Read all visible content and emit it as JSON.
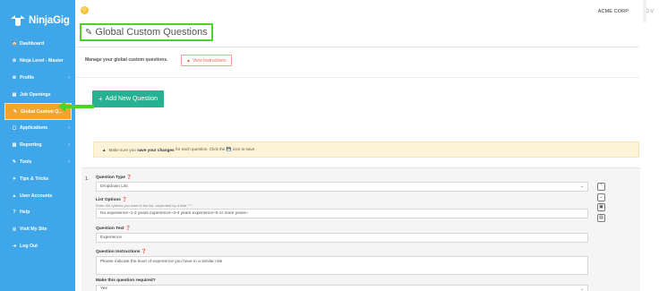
{
  "brand": {
    "name": "NinjaGig"
  },
  "topbar": {
    "company": "ACME CORP",
    "user_short": "⏻ V"
  },
  "sidebar": {
    "items": [
      {
        "label": "Dashboard",
        "icon": "🏠",
        "has_chevron": false
      },
      {
        "label": "Ninja Level - Master",
        "icon": "⚙",
        "has_chevron": false
      },
      {
        "label": "Profile",
        "icon": "⚙",
        "has_chevron": true
      },
      {
        "label": "Job Openings",
        "icon": "▤",
        "has_chevron": false
      },
      {
        "label": "Global Custom Q...",
        "icon": "✎",
        "has_chevron": false,
        "active": true
      },
      {
        "label": "Applications",
        "icon": "▢",
        "has_chevron": true
      },
      {
        "label": "Reporting",
        "icon": "▥",
        "has_chevron": true
      },
      {
        "label": "Tools",
        "icon": "✎",
        "has_chevron": true
      },
      {
        "label": "Tips & Tricks",
        "icon": "✦",
        "has_chevron": false
      },
      {
        "label": "User Accounts",
        "icon": "▲",
        "has_chevron": false
      },
      {
        "label": "Help",
        "icon": "?",
        "has_chevron": false
      },
      {
        "label": "Visit My Site",
        "icon": "◎",
        "has_chevron": false
      },
      {
        "label": "Log Out",
        "icon": "⇥",
        "has_chevron": false
      }
    ]
  },
  "page": {
    "title": "Global Custom Questions",
    "description": "Manage your global custom questions.",
    "view_instructions": "View Instructions",
    "add_button": "Add New Question",
    "alert_prefix": "Make sure you",
    "alert_bold": "save your changes",
    "alert_suffix": "for each question. Click the 💾 icon to save."
  },
  "question": {
    "number": "1.",
    "type_label": "Question Type ❓",
    "type_value": "Dropdown List",
    "options_label": "List Options ❓",
    "options_hint": "Enter the options you want in the list, separated by a tilde \"~\".",
    "options_value": "No experience~1-2 years experience~3-4 years experience~5 or more years~",
    "text_label": "Question Text ❓",
    "text_value": "Experience",
    "instructions_label": "Question Instructions ❓",
    "instructions_value": "Please indicate the level of experience you have in a similar role",
    "required_label": "Make this question required?",
    "required_value": "Yes"
  },
  "colors": {
    "sidebar": "#3fa7e9",
    "active": "#f3a42c",
    "highlight": "#4cd22a",
    "add_button": "#27b091"
  }
}
